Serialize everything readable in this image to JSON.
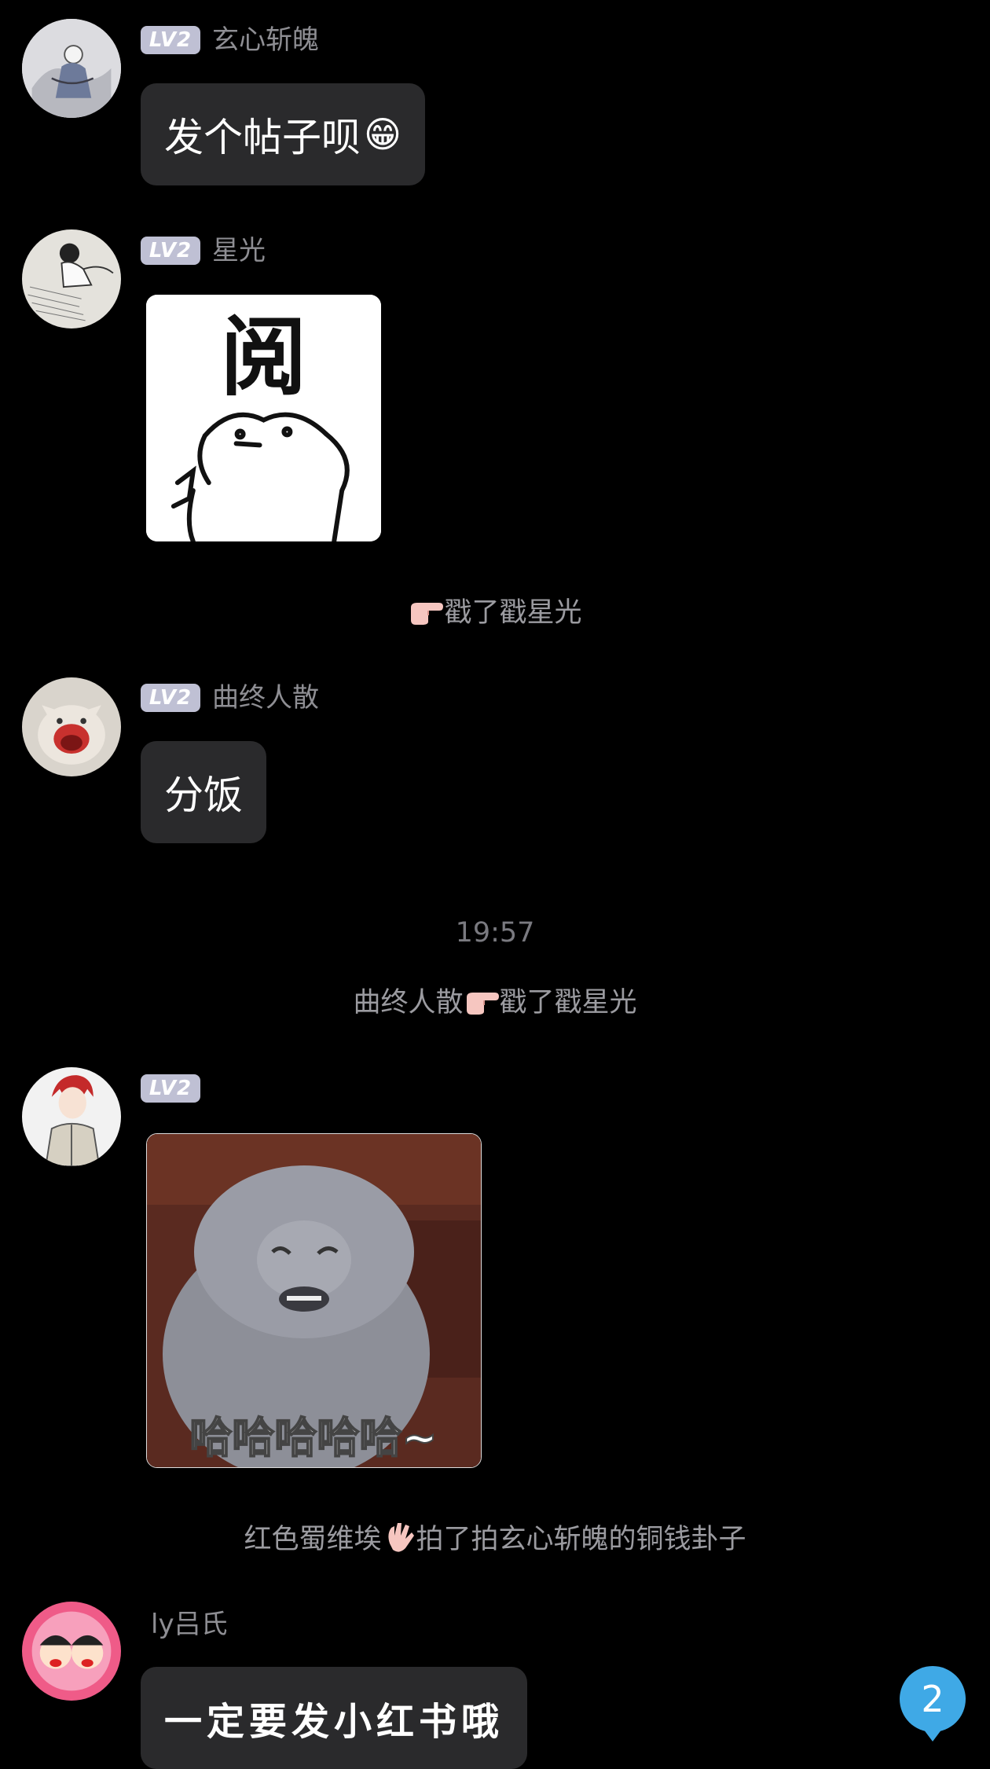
{
  "messages": [
    {
      "sender": "玄心斩魄",
      "level": "LV2",
      "text": "发个帖子呗",
      "emoji": "😁"
    },
    {
      "sender": "星光",
      "level": "LV2",
      "sticker_caption": "阅"
    },
    {
      "system": "戳了戳星光",
      "system_icon": "pointing-hand-icon"
    },
    {
      "sender": "曲终人散",
      "level": "LV2",
      "text": "分饭"
    },
    {
      "time": "19:57"
    },
    {
      "system_prefix": "曲终人散",
      "system": "戳了戳星光",
      "system_icon": "pointing-hand-icon"
    },
    {
      "sender": "",
      "level": "LV2",
      "sticker_caption": "哈哈哈哈哈~"
    },
    {
      "system_prefix": "红色蜀维埃",
      "system": "拍了拍玄心斩魄的铜钱卦子",
      "system_icon": "waving-hand-icon"
    },
    {
      "sender": "ly吕氏",
      "text": "一定要发小红书哦"
    }
  ],
  "unread_badge": "2",
  "colors": {
    "background": "#000000",
    "bubble": "#2a2a2c",
    "level_badge": "#bfc0d4",
    "unread": "#3fa9e6"
  }
}
